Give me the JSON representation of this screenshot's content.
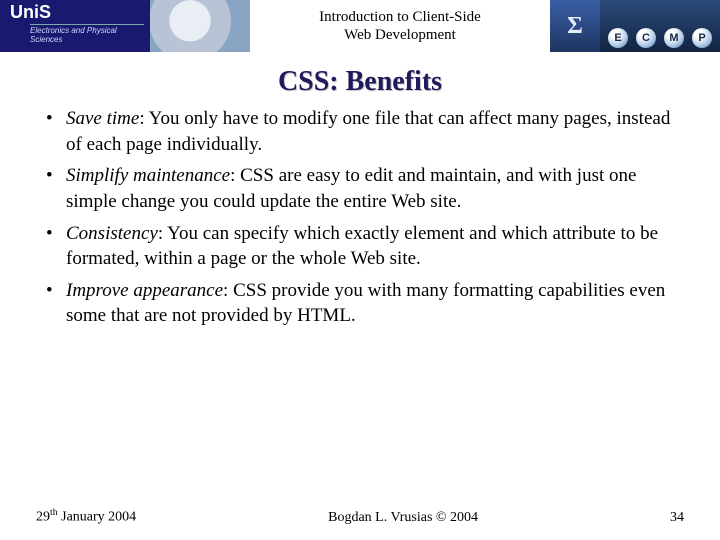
{
  "banner": {
    "uni_logo_text": "UniS",
    "dept_text": "Electronics and Physical Sciences",
    "course_title_line1": "Introduction to Client-Side",
    "course_title_line2": "Web Development",
    "sigma": "Σ",
    "letters": [
      "E",
      "C",
      "M",
      "P"
    ]
  },
  "heading": "CSS: Benefits",
  "bullets": [
    {
      "term": "Save time",
      "rest": ": You only have to modify one file that can affect many pages, instead of each page individually."
    },
    {
      "term": "Simplify maintenance",
      "rest": ": CSS are easy to edit and maintain, and with just one simple change you could update the entire Web site."
    },
    {
      "term": "Consistency",
      "rest": ": You can specify which exactly element and which attribute to be formated, within a page or the whole Web site."
    },
    {
      "term": "Improve appearance",
      "rest": ": CSS provide you with many formatting capabilities even some that are not provided by HTML."
    }
  ],
  "footer": {
    "date_day": "29",
    "date_suffix": "th",
    "date_rest": " January 2004",
    "author": "Bogdan L. Vrusias © 2004",
    "page_number": "34"
  }
}
